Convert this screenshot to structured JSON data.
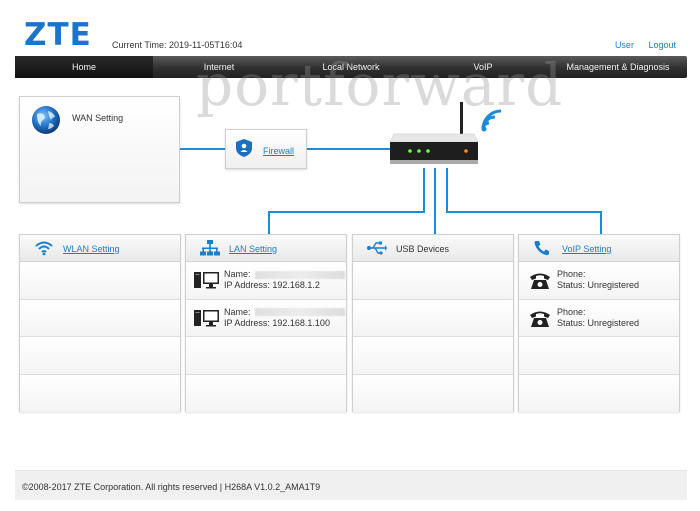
{
  "header": {
    "logo": "ZTE",
    "current_time_label": "Current Time:",
    "current_time_value": "2019-11-05T16:04",
    "user_link": "User",
    "logout_link": "Logout"
  },
  "watermark": "portforward",
  "nav": {
    "items": [
      {
        "label": "Home",
        "active": true
      },
      {
        "label": "Internet"
      },
      {
        "label": "Local Network"
      },
      {
        "label": "VoIP"
      },
      {
        "label": "Management & Diagnosis"
      }
    ]
  },
  "topology": {
    "wan_label": "WAN Setting",
    "firewall_label": "Firewall",
    "line_color": "#1a8cd8"
  },
  "panels": [
    {
      "title": "WLAN Setting",
      "link": true,
      "icon": "wifi-icon",
      "rows": []
    },
    {
      "title": "LAN Setting",
      "link": true,
      "icon": "network-icon",
      "rows": [
        {
          "name_label": "Name:",
          "ip_label": "IP Address:",
          "ip": "192.168.1.2"
        },
        {
          "name_label": "Name:",
          "ip_label": "IP Address:",
          "ip": "192.168.1.100"
        }
      ]
    },
    {
      "title": "USB Devices",
      "link": false,
      "icon": "usb-icon",
      "rows": []
    },
    {
      "title": "VoIP Setting",
      "link": true,
      "icon": "phone-icon",
      "rows": [
        {
          "phone_label": "Phone:",
          "status_label": "Status:",
          "status": "Unregistered"
        },
        {
          "phone_label": "Phone:",
          "status_label": "Status:",
          "status": "Unregistered"
        }
      ]
    }
  ],
  "footer": {
    "text": "©2008-2017 ZTE Corporation. All rights reserved  |   H268A V1.0.2_AMA1T9"
  },
  "colors": {
    "brand": "#1d74c9",
    "link": "#1a7ec8",
    "nav_dark": "#303030"
  }
}
